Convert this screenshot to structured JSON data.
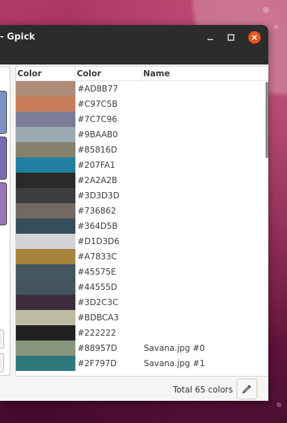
{
  "window": {
    "title": "- Gpick",
    "controls": {
      "minimize": "minimize-icon",
      "maximize": "maximize-icon",
      "close": "close-icon"
    }
  },
  "colors": {
    "accent_close": "#E95420",
    "titlebar": "#2C2C2C",
    "window_bg": "#F6F5F4"
  },
  "side_panel": {
    "swatches": [
      "#7C92C2",
      "#7A6CB0",
      "#9A75B8"
    ]
  },
  "palette_list": {
    "columns": [
      "Color",
      "Color",
      "Name"
    ],
    "rows": [
      {
        "hex": "#AD8B77",
        "name": ""
      },
      {
        "hex": "#C97C5B",
        "name": ""
      },
      {
        "hex": "#7C7C96",
        "name": ""
      },
      {
        "hex": "#9BAAB0",
        "name": ""
      },
      {
        "hex": "#85816D",
        "name": ""
      },
      {
        "hex": "#207FA1",
        "name": ""
      },
      {
        "hex": "#2A2A2B",
        "name": ""
      },
      {
        "hex": "#3D3D3D",
        "name": ""
      },
      {
        "hex": "#736862",
        "name": ""
      },
      {
        "hex": "#364D5B",
        "name": ""
      },
      {
        "hex": "#D1D3D6",
        "name": ""
      },
      {
        "hex": "#A7833C",
        "name": ""
      },
      {
        "hex": "#45575E",
        "name": ""
      },
      {
        "hex": "#44555D",
        "name": ""
      },
      {
        "hex": "#3D2C3C",
        "name": ""
      },
      {
        "hex": "#BDBCA3",
        "name": ""
      },
      {
        "hex": "#222222",
        "name": ""
      },
      {
        "hex": "#88957D",
        "name": "Savana.jpg #0"
      },
      {
        "hex": "#2F797D",
        "name": "Savana.jpg #1"
      }
    ]
  },
  "status": {
    "total": "Total 65 colors",
    "picker_icon": "color-picker-icon"
  }
}
